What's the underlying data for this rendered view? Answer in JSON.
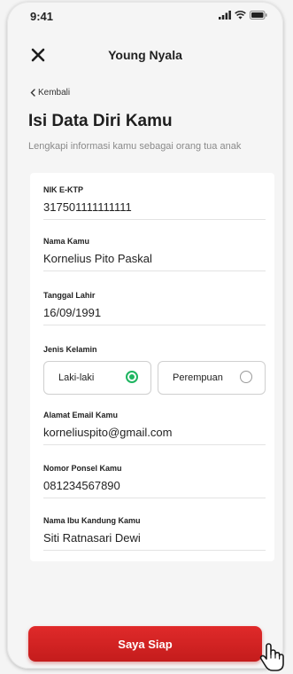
{
  "status_bar": {
    "time": "9:41"
  },
  "app_bar": {
    "title": "Young Nyala"
  },
  "back_label": "Kembali",
  "page": {
    "title": "Isi Data Diri Kamu",
    "subtitle": "Lengkapi informasi kamu sebagai orang tua anak"
  },
  "form": {
    "nik": {
      "label": "NIK E-KTP",
      "value": "317501111111111"
    },
    "name": {
      "label": "Nama Kamu",
      "value": "Kornelius Pito Paskal"
    },
    "dob": {
      "label": "Tanggal Lahir",
      "value": "16/09/1991"
    },
    "gender": {
      "label": "Jenis Kelamin",
      "options": [
        "Laki-laki",
        "Perempuan"
      ],
      "selected": "Laki-laki"
    },
    "email": {
      "label": "Alamat Email Kamu",
      "value": "korneliuspito@gmail.com"
    },
    "phone": {
      "label": "Nomor Ponsel Kamu",
      "value": "081234567890"
    },
    "mother": {
      "label": "Nama Ibu Kandung Kamu",
      "value": "Siti Ratnasari Dewi"
    }
  },
  "cta_label": "Saya Siap",
  "colors": {
    "primary": "#d42222",
    "radio_selected": "#1fb561"
  },
  "icons": [
    "signal-icon",
    "wifi-icon",
    "battery-icon",
    "close-icon",
    "chevron-left-icon",
    "hand-pointer-icon"
  ]
}
